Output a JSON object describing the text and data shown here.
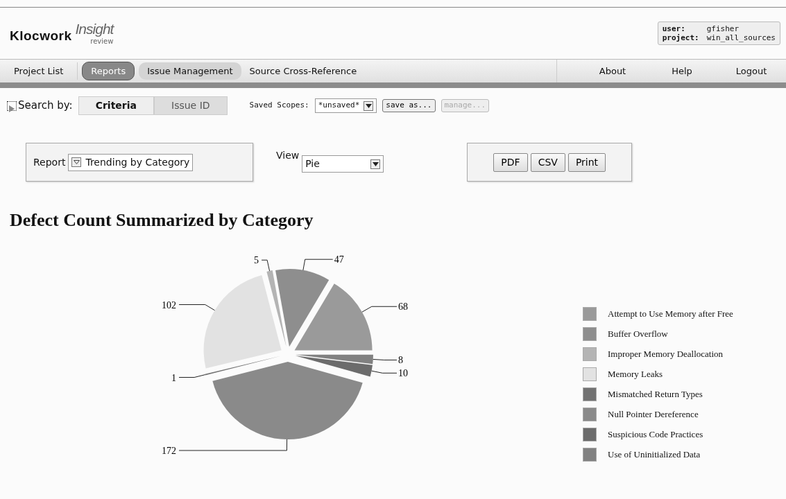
{
  "header": {
    "logo": {
      "brand": "Klocwork",
      "product": "Insight",
      "edition": "review"
    },
    "user_info": {
      "user_label": "user:",
      "user": "gfisher",
      "project_label": "project:",
      "project": "win_all_sources"
    }
  },
  "nav": {
    "left": [
      {
        "label": "Project List",
        "selected": false,
        "highlighted": false
      },
      {
        "label": "Reports",
        "selected": true,
        "highlighted": false
      },
      {
        "label": "Issue Management",
        "selected": false,
        "highlighted": true
      },
      {
        "label": "Source Cross-Reference",
        "selected": false,
        "highlighted": false
      }
    ],
    "right": [
      {
        "label": "About"
      },
      {
        "label": "Help"
      },
      {
        "label": "Logout"
      }
    ]
  },
  "search": {
    "label": "Search by:",
    "expanded": false,
    "tabs": [
      {
        "label": "Criteria",
        "selected": true
      },
      {
        "label": "Issue ID",
        "selected": false
      }
    ],
    "saved_scopes": {
      "label": "Saved Scopes:",
      "value": "*unsaved*"
    },
    "buttons": [
      {
        "label": "save as...",
        "disabled": false
      },
      {
        "label": "manage...",
        "disabled": true
      }
    ]
  },
  "report": {
    "label": "Report",
    "value": "Trending by Category"
  },
  "view": {
    "label": "View",
    "value": "Pie"
  },
  "exports": [
    "PDF",
    "CSV",
    "Print"
  ],
  "chart": {
    "chart_data": {
      "type": "pie",
      "title": "Defect Count Summarized by Category",
      "data_labels": true,
      "legend": "right",
      "categories": [
        "Attempt to Use Memory after Free",
        "Buffer Overflow",
        "Improper Memory Deallocation",
        "Memory Leaks",
        "Mismatched Return Types",
        "Null Pointer Dereference",
        "Suspicious Code Practices",
        "Use of Uninitialized Data"
      ],
      "series": [
        {
          "values": [
            68,
            47,
            5,
            102,
            1,
            172,
            10,
            8
          ],
          "colors": [
            "#9a9a9a",
            "#8e8e8e",
            "#b4b4b4",
            "#e2e2e2",
            "#727272",
            "#8a8a8a",
            "#6c6c6c",
            "#818181"
          ]
        }
      ]
    }
  }
}
